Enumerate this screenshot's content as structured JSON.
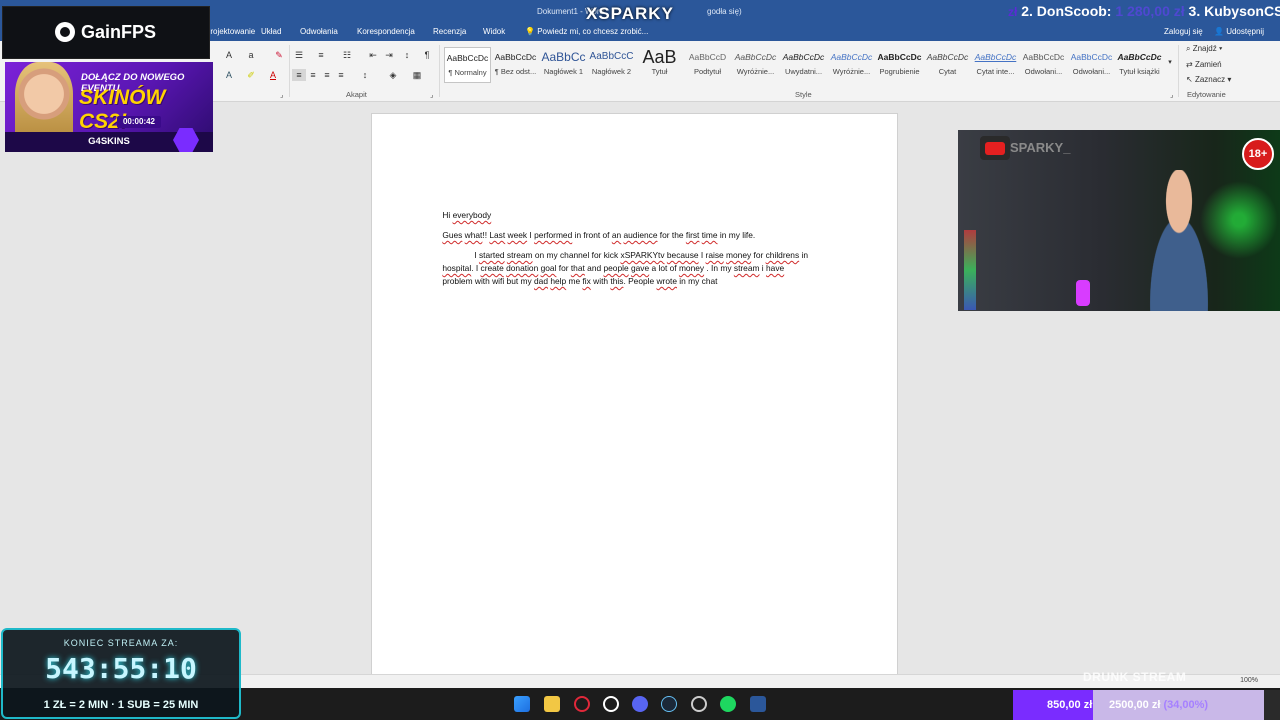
{
  "titlebar": {
    "doc_title": "Dokument1 - Word",
    "doc_title_tail": "godła się)",
    "overlay_name": "XSPARKY",
    "tell_me": "Powiedz mi, co chcesz zrobić...",
    "sign_in": "Zaloguj się",
    "share": "Udostępnij"
  },
  "tabs": [
    "Projektowanie",
    "Układ",
    "Odwołania",
    "Korespondencja",
    "Recenzja",
    "Widok"
  ],
  "ribbon": {
    "group_paragraph": "Akapit",
    "group_styles": "Style",
    "group_editing": "Edytowanie",
    "styles": [
      {
        "preview": "AaBbCcDc",
        "name": "¶ Normalny"
      },
      {
        "preview": "AaBbCcDc",
        "name": "¶ Bez odst..."
      },
      {
        "preview": "AaBbCc",
        "name": "Nagłówek 1"
      },
      {
        "preview": "AaBbCcC",
        "name": "Nagłówek 2"
      },
      {
        "preview": "AaB",
        "name": "Tytuł"
      },
      {
        "preview": "AaBbCcD",
        "name": "Podtytuł"
      },
      {
        "preview": "AaBbCcDc",
        "name": "Wyróżnie..."
      },
      {
        "preview": "AaBbCcDc",
        "name": "Uwydatni..."
      },
      {
        "preview": "AaBbCcDc",
        "name": "Wyróżnie..."
      },
      {
        "preview": "AaBbCcDc",
        "name": "Pogrubienie"
      },
      {
        "preview": "AaBbCcDc",
        "name": "Cytat"
      },
      {
        "preview": "AaBbCcDc",
        "name": "Cytat inte..."
      },
      {
        "preview": "AaBbCcDc",
        "name": "Odwołani..."
      },
      {
        "preview": "AaBbCcDc",
        "name": "Odwołani..."
      },
      {
        "preview": "AaBbCcDc",
        "name": "Tytuł książki"
      }
    ],
    "editing": {
      "find": "Znajdź",
      "replace": "Zamień",
      "select": "Zaznacz"
    }
  },
  "document": {
    "line1": [
      "Hi ",
      "everybody"
    ],
    "line2": [
      "Gues",
      " ",
      "what",
      "!! ",
      "Last",
      " ",
      "week",
      " I ",
      "performed",
      " in front of ",
      "an",
      " ",
      "audience",
      " for the ",
      "first",
      " ",
      "time",
      " in my life."
    ],
    "line3": [
      "I ",
      "started",
      " ",
      "stream",
      " on my channel for kick ",
      "xSPARKYtv",
      " ",
      "because",
      " I ",
      "raise",
      " ",
      "money",
      " for ",
      "childrens",
      " in"
    ],
    "line4": [
      "hospital",
      ". I ",
      "create",
      " ",
      "donation",
      " ",
      "goal",
      " for ",
      "that",
      " and ",
      "people",
      " ",
      "gave",
      " a lot of ",
      "money",
      " . In my ",
      "stream",
      " i ",
      "have"
    ],
    "line5": [
      "problem with wifi but my ",
      "dad",
      " ",
      "help",
      " me ",
      "fix",
      " with ",
      "this",
      ". People ",
      "wrote",
      " in my chat"
    ]
  },
  "statusbar": {
    "zoom": "100%"
  },
  "overlays": {
    "gainfps": "GainFPS",
    "banner_line1": "DOŁĄCZ DO NOWEGO EVENTU",
    "banner_line2": "SKINÓW CS2!",
    "banner_timer": "00:00:42",
    "banner_brand": "G4SKINS",
    "ticker_zl": "zł",
    "ticker_second": "2. DonScoob:",
    "ticker_second_amount": "1 280,00 zł",
    "ticker_third": "3. KubysonCS",
    "channel": "SPARKY_",
    "age_badge": "18+",
    "countdown_label": "KONIEC STREAMA ZA:",
    "countdown_time": "543:55:10",
    "countdown_rate": "1 ZŁ = 2 MIN · 1 SUB = 25 MIN",
    "goal_current": "850,00 zł",
    "goal_target": "2500,00 zł",
    "goal_percent": "(34,00%)",
    "goal_fraction": 0.34,
    "drunk": "DRUNK STREAM"
  },
  "colors": {
    "word_blue": "#2b579a",
    "accent_purple": "#7a2cff",
    "squiggle": "#d02b2b"
  }
}
